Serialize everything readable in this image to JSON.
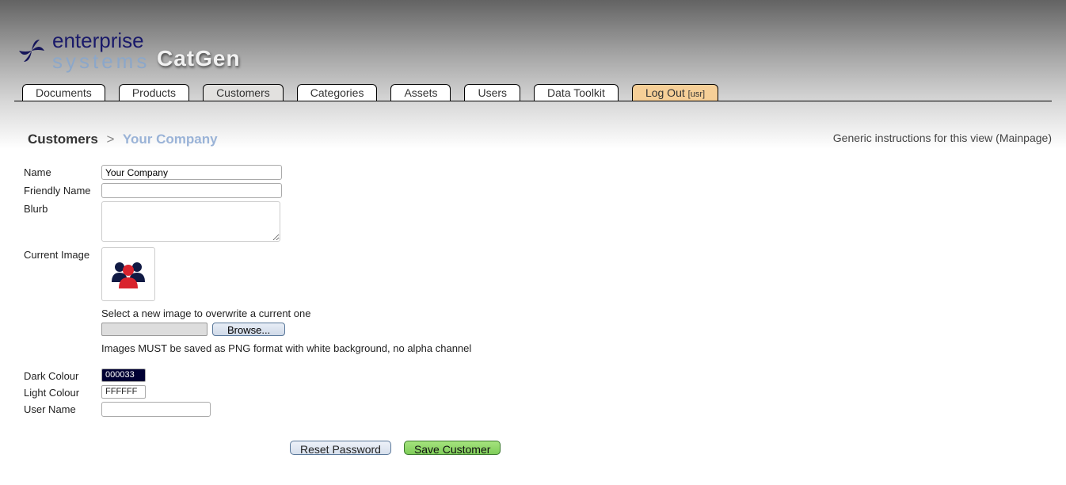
{
  "logo": {
    "line1": "enterprise",
    "line2": "systems"
  },
  "app_name": "CatGen",
  "tabs": [
    {
      "label": "Documents"
    },
    {
      "label": "Products"
    },
    {
      "label": "Customers"
    },
    {
      "label": "Categories"
    },
    {
      "label": "Assets"
    },
    {
      "label": "Users"
    },
    {
      "label": "Data Toolkit"
    },
    {
      "label": "Log Out ",
      "sub": "[usr]"
    }
  ],
  "breadcrumb": {
    "root": "Customers",
    "sep": ">",
    "leaf": "Your Company"
  },
  "top_hint": "Generic instructions for this view (Mainpage)",
  "form": {
    "labels": {
      "name": "Name",
      "friendly": "Friendly Name",
      "blurb": "Blurb",
      "current_image": "Current Image",
      "dark": "Dark Colour",
      "light": "Light Colour",
      "user": "User Name"
    },
    "values": {
      "name": "Your Company",
      "friendly": "",
      "blurb": "",
      "dark": "000033",
      "light": "FFFFFF",
      "user": ""
    },
    "help_select": "Select a new image to overwrite a current one",
    "browse_label": "Browse...",
    "note": "Images MUST be saved as PNG format with white background, no alpha channel",
    "image_icon": "group-icon"
  },
  "buttons": {
    "reset": "Reset Password",
    "save": "Save Customer"
  },
  "colors": {
    "dark": "#000033",
    "light": "#FFFFFF"
  }
}
